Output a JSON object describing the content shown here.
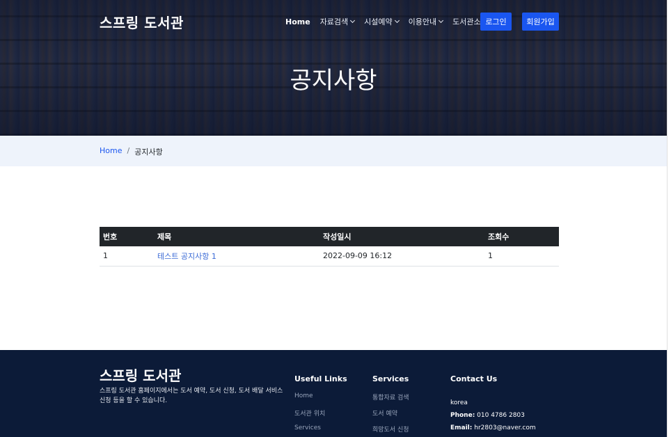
{
  "header": {
    "logo": "스프링 도서관",
    "nav": [
      {
        "label": "Home",
        "dropdown": false
      },
      {
        "label": "자료검색",
        "dropdown": true
      },
      {
        "label": "시설예약",
        "dropdown": true
      },
      {
        "label": "이용안내",
        "dropdown": true
      },
      {
        "label": "도서관소식",
        "dropdown": true
      }
    ],
    "login_label": "로그인",
    "join_label": "회원가입"
  },
  "hero": {
    "title": "공지사항"
  },
  "breadcrumb": {
    "home": "Home",
    "separator": "/",
    "current": "공지사항"
  },
  "table": {
    "headers": [
      "번호",
      "제목",
      "작성일시",
      "조회수"
    ],
    "rows": [
      {
        "no": "1",
        "title": "테스트 공지사항 1",
        "date": "2022-09-09 16:12",
        "views": "1"
      }
    ]
  },
  "footer": {
    "logo": "스프링 도서관",
    "description": "스프링 도서관 홈페이지에서는 도서 예약, 도서 신청, 도서 배달 서비스 신청 등을 할 수 있습니다.",
    "useful_links": {
      "title": "Useful Links",
      "items": [
        "Home",
        "도서관 위치",
        "Services"
      ]
    },
    "services": {
      "title": "Services",
      "items": [
        "통합자료 검색",
        "도서 예약",
        "희망도서 신청"
      ]
    },
    "contact": {
      "title": "Contact Us",
      "country": "korea",
      "phone_label": "Phone:",
      "phone": "010 4786 2803",
      "email_label": "Email:",
      "email": "hr2803@naver.com"
    }
  },
  "colors": {
    "accent": "#1a56f0",
    "footer_bg": "#0c1b38",
    "table_head": "#212529",
    "breadcrumb_bg": "#eef3fb"
  }
}
